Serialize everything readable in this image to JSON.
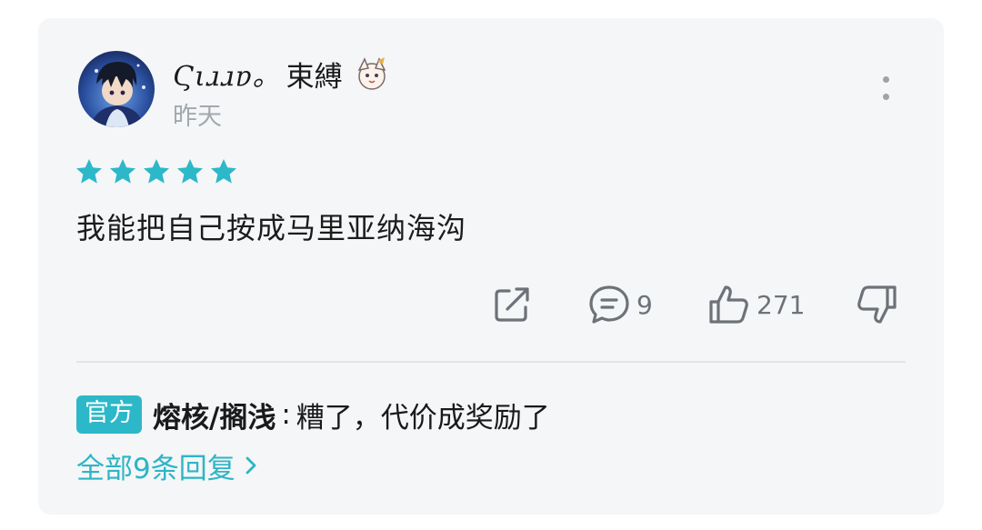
{
  "comment": {
    "user_name_script": "Ϛιɹɹɐ。",
    "user_name_cn": "束縛",
    "time": "昨天",
    "rating": 5,
    "rating_max": 5,
    "text": "我能把自己按成马里亚纳海沟",
    "reply_count": "9",
    "like_count": "271"
  },
  "reply": {
    "badge": "官方",
    "author": "熔核/搁浅",
    "separator": ":",
    "text": "糟了，代价成奖励了"
  },
  "view_all_label": "全部9条回复",
  "colors": {
    "accent": "#2cb8c8",
    "card_bg": "#f4f6f8",
    "icon_gray": "#6d7278",
    "meta_gray": "#a3a8ae"
  },
  "icons": [
    "more-vertical-icon",
    "star-icon",
    "share-icon",
    "comment-icon",
    "thumbs-up-icon",
    "thumbs-down-icon",
    "chevron-right-icon"
  ]
}
